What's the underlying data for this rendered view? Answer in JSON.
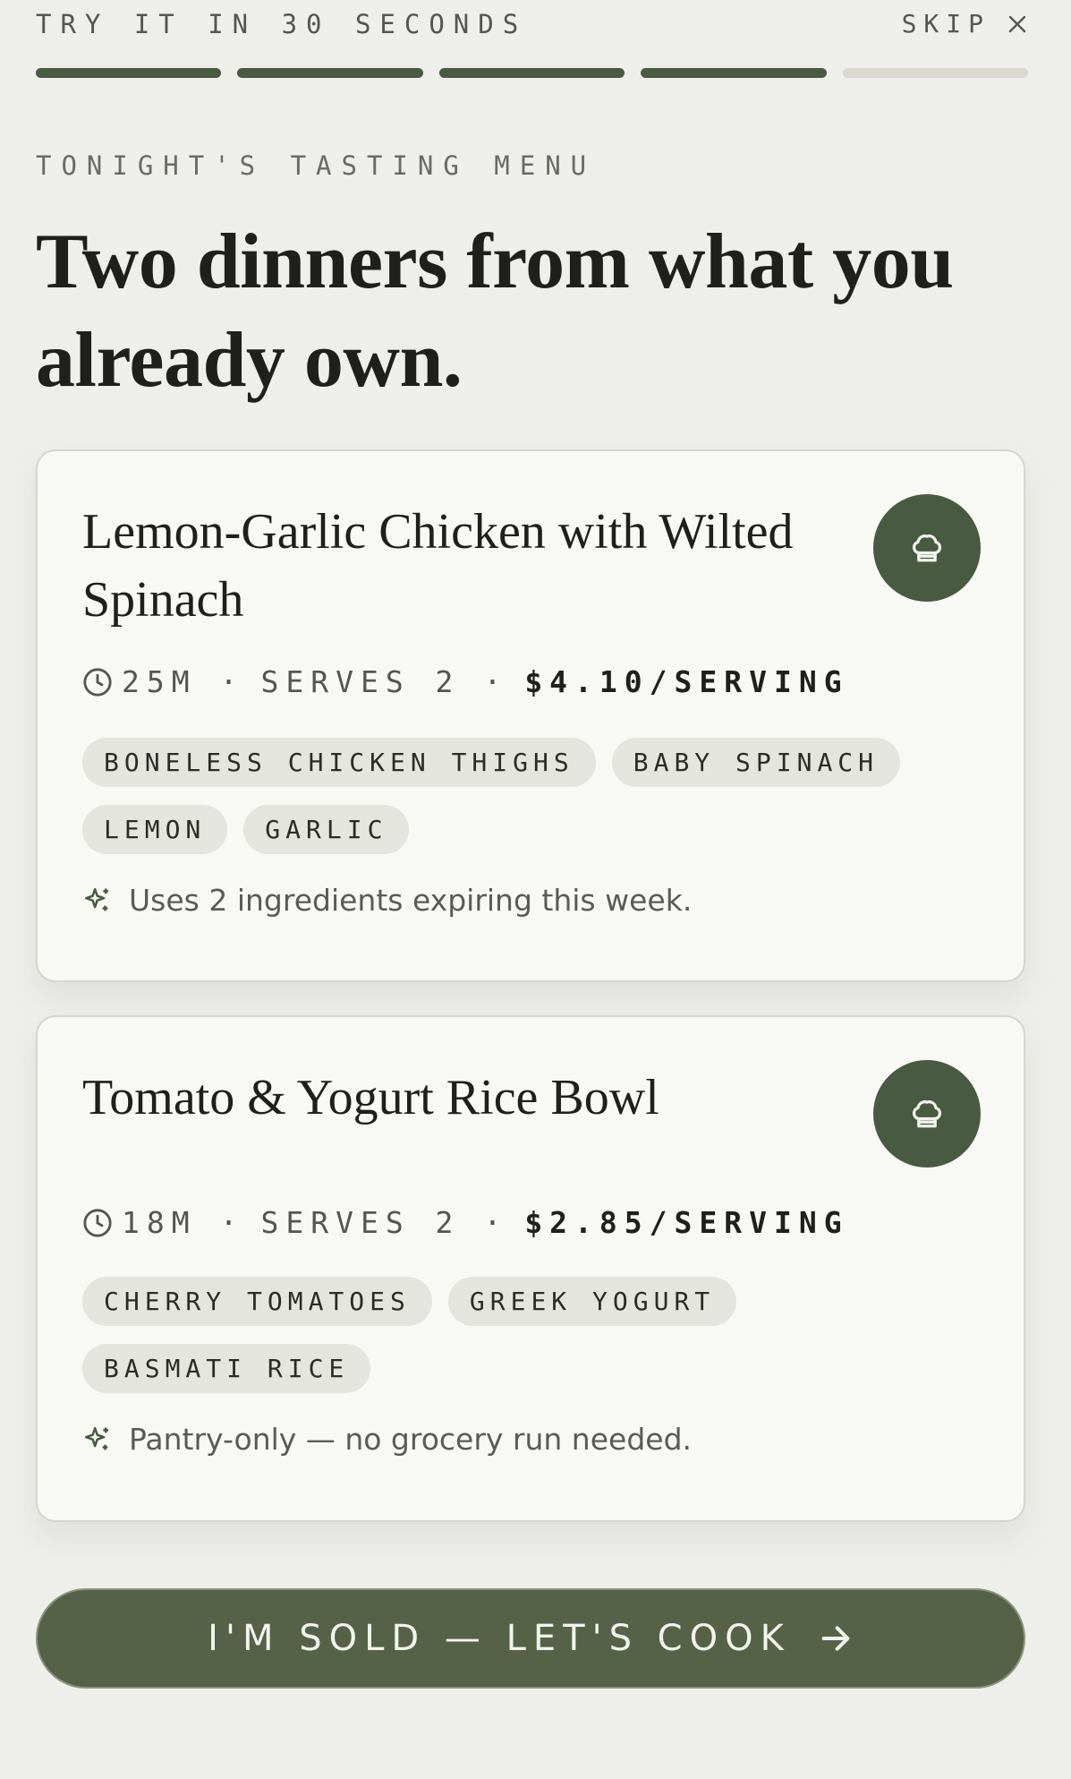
{
  "header": {
    "step_title": "TRY IT IN 30 SECONDS",
    "skip_label": "SKIP",
    "progress": {
      "total_steps": 5,
      "completed_steps": 4
    }
  },
  "eyebrow": "TONIGHT'S TASTING MENU",
  "headline": "Two dinners from what you already own.",
  "recipes": [
    {
      "title": "Lemon-Garlic Chicken with Wilted Spinach",
      "time": "25M",
      "serves": "SERVES 2",
      "separator": "·",
      "price": "$4.10/SERVING",
      "tags": [
        "BONELESS CHICKEN THIGHS",
        "BABY SPINACH",
        "LEMON",
        "GARLIC"
      ],
      "note": "Uses 2 ingredients expiring this week."
    },
    {
      "title": "Tomato & Yogurt Rice Bowl",
      "time": "18M",
      "serves": "SERVES 2",
      "separator": "·",
      "price": "$2.85/SERVING",
      "tags": [
        "CHERRY TOMATOES",
        "GREEK YOGURT",
        "BASMATI RICE"
      ],
      "note": "Pantry-only — no grocery run needed."
    }
  ],
  "cta_label": "I'M SOLD — LET'S COOK",
  "icons": {
    "skip": "close-icon",
    "recipe_action": "chef-hat-icon",
    "time": "clock-icon",
    "note": "sparkle-icon",
    "cta": "arrow-right-icon"
  },
  "colors": {
    "background": "#eeeeea",
    "accent": "#485a3f",
    "cta": "#566247",
    "card": "#f8f8f5",
    "tag": "#e5e5df",
    "progress_inactive": "#d9d9d2"
  }
}
